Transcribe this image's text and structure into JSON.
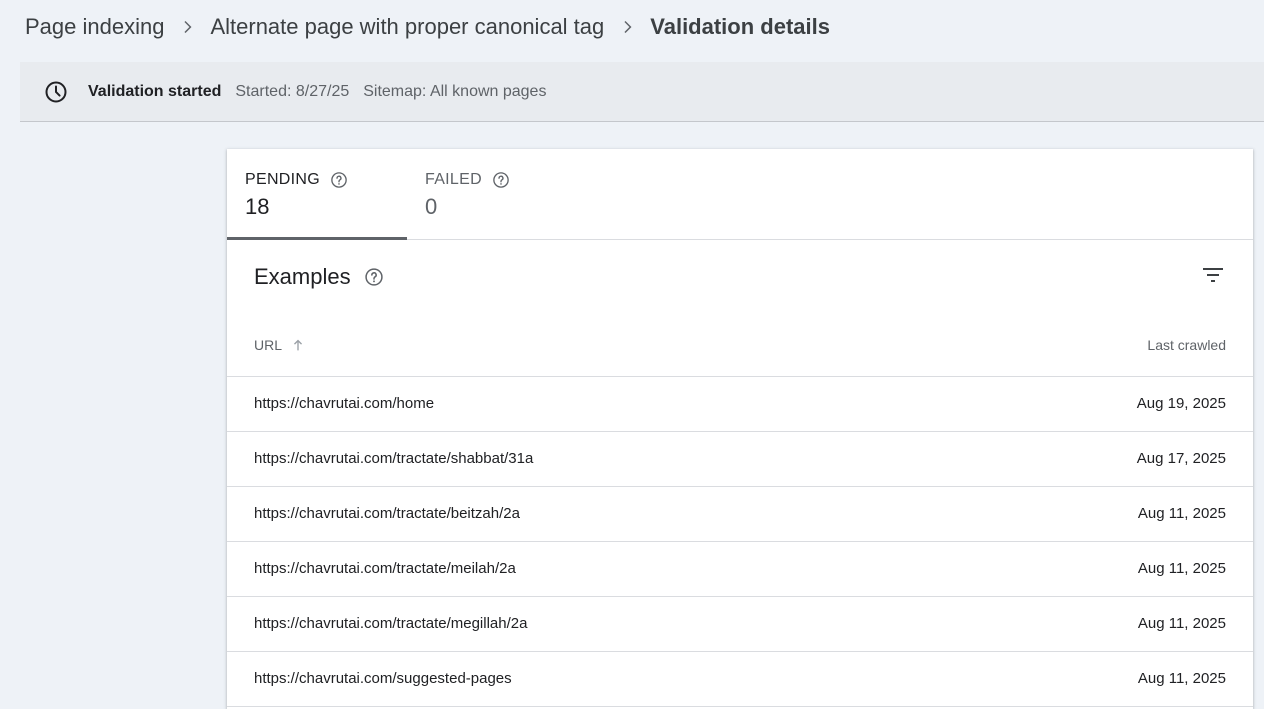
{
  "breadcrumb": {
    "items": [
      "Page indexing",
      "Alternate page with proper canonical tag"
    ],
    "current": "Validation details"
  },
  "banner": {
    "icon": "clock-icon",
    "status": "Validation started",
    "started": "Started: 8/27/25",
    "sitemap": "Sitemap: All known pages"
  },
  "tabs": [
    {
      "label": "PENDING",
      "count": "18",
      "active": true
    },
    {
      "label": "FAILED",
      "count": "0",
      "active": false
    }
  ],
  "examples": {
    "title": "Examples",
    "filter_icon": "filter-icon",
    "columns": {
      "url": "URL",
      "last_crawled": "Last crawled"
    },
    "rows": [
      {
        "url": "https://chavrutai.com/home",
        "date": "Aug 19, 2025"
      },
      {
        "url": "https://chavrutai.com/tractate/shabbat/31a",
        "date": "Aug 17, 2025"
      },
      {
        "url": "https://chavrutai.com/tractate/beitzah/2a",
        "date": "Aug 11, 2025"
      },
      {
        "url": "https://chavrutai.com/tractate/meilah/2a",
        "date": "Aug 11, 2025"
      },
      {
        "url": "https://chavrutai.com/tractate/megillah/2a",
        "date": "Aug 11, 2025"
      },
      {
        "url": "https://chavrutai.com/suggested-pages",
        "date": "Aug 11, 2025"
      }
    ]
  }
}
